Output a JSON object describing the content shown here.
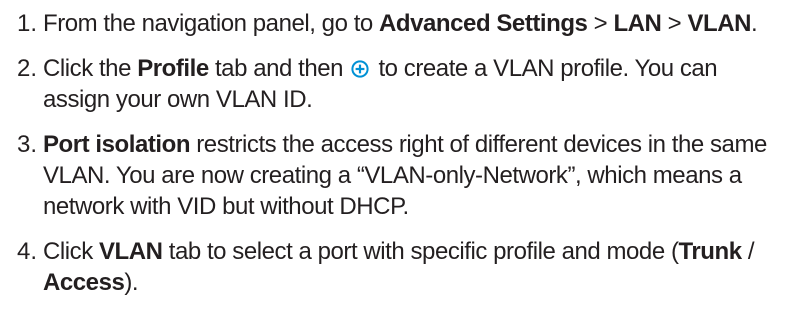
{
  "steps": [
    {
      "number": "1.",
      "parts": [
        {
          "text": "From the navigation panel, go to ",
          "bold": false
        },
        {
          "text": "Advanced Settings",
          "bold": true
        },
        {
          "text": " > ",
          "bold": false
        },
        {
          "text": "LAN",
          "bold": true
        },
        {
          "text": " > ",
          "bold": false
        },
        {
          "text": "VLAN",
          "bold": true
        },
        {
          "text": ".",
          "bold": false
        }
      ]
    },
    {
      "number": "2.",
      "parts": [
        {
          "text": "Click the ",
          "bold": false
        },
        {
          "text": "Profile",
          "bold": true
        },
        {
          "text": " tab and then ",
          "bold": false
        },
        {
          "icon": "plus-circle-icon",
          "color": "#0091d5"
        },
        {
          "text": " to create a VLAN profile. You can assign your own VLAN ID.",
          "bold": false
        }
      ]
    },
    {
      "number": "3.",
      "parts": [
        {
          "text": "Port isolation",
          "bold": true
        },
        {
          "text": " restricts the access right of different devices in the same VLAN. You are now creating a “VLAN-only-Network”, which means a network with VID but without DHCP.",
          "bold": false
        }
      ]
    },
    {
      "number": "4.",
      "parts": [
        {
          "text": "Click ",
          "bold": false
        },
        {
          "text": "VLAN",
          "bold": true
        },
        {
          "text": " tab to select a port with specific profile and mode (",
          "bold": false
        },
        {
          "text": "Trunk",
          "bold": true
        },
        {
          "text": " / ",
          "bold": false
        },
        {
          "text": "Access",
          "bold": true
        },
        {
          "text": ").",
          "bold": false
        }
      ]
    }
  ]
}
